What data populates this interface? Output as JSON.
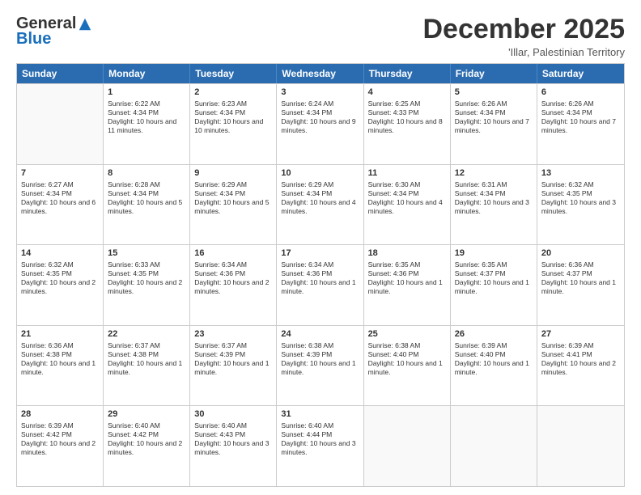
{
  "logo": {
    "general": "General",
    "blue": "Blue"
  },
  "title": "December 2025",
  "subtitle": "'Illar, Palestinian Territory",
  "header_days": [
    "Sunday",
    "Monday",
    "Tuesday",
    "Wednesday",
    "Thursday",
    "Friday",
    "Saturday"
  ],
  "weeks": [
    [
      {
        "day": "",
        "info": ""
      },
      {
        "day": "1",
        "info": "Sunrise: 6:22 AM\nSunset: 4:34 PM\nDaylight: 10 hours and 11 minutes."
      },
      {
        "day": "2",
        "info": "Sunrise: 6:23 AM\nSunset: 4:34 PM\nDaylight: 10 hours and 10 minutes."
      },
      {
        "day": "3",
        "info": "Sunrise: 6:24 AM\nSunset: 4:34 PM\nDaylight: 10 hours and 9 minutes."
      },
      {
        "day": "4",
        "info": "Sunrise: 6:25 AM\nSunset: 4:33 PM\nDaylight: 10 hours and 8 minutes."
      },
      {
        "day": "5",
        "info": "Sunrise: 6:26 AM\nSunset: 4:34 PM\nDaylight: 10 hours and 7 minutes."
      },
      {
        "day": "6",
        "info": "Sunrise: 6:26 AM\nSunset: 4:34 PM\nDaylight: 10 hours and 7 minutes."
      }
    ],
    [
      {
        "day": "7",
        "info": "Sunrise: 6:27 AM\nSunset: 4:34 PM\nDaylight: 10 hours and 6 minutes."
      },
      {
        "day": "8",
        "info": "Sunrise: 6:28 AM\nSunset: 4:34 PM\nDaylight: 10 hours and 5 minutes."
      },
      {
        "day": "9",
        "info": "Sunrise: 6:29 AM\nSunset: 4:34 PM\nDaylight: 10 hours and 5 minutes."
      },
      {
        "day": "10",
        "info": "Sunrise: 6:29 AM\nSunset: 4:34 PM\nDaylight: 10 hours and 4 minutes."
      },
      {
        "day": "11",
        "info": "Sunrise: 6:30 AM\nSunset: 4:34 PM\nDaylight: 10 hours and 4 minutes."
      },
      {
        "day": "12",
        "info": "Sunrise: 6:31 AM\nSunset: 4:34 PM\nDaylight: 10 hours and 3 minutes."
      },
      {
        "day": "13",
        "info": "Sunrise: 6:32 AM\nSunset: 4:35 PM\nDaylight: 10 hours and 3 minutes."
      }
    ],
    [
      {
        "day": "14",
        "info": "Sunrise: 6:32 AM\nSunset: 4:35 PM\nDaylight: 10 hours and 2 minutes."
      },
      {
        "day": "15",
        "info": "Sunrise: 6:33 AM\nSunset: 4:35 PM\nDaylight: 10 hours and 2 minutes."
      },
      {
        "day": "16",
        "info": "Sunrise: 6:34 AM\nSunset: 4:36 PM\nDaylight: 10 hours and 2 minutes."
      },
      {
        "day": "17",
        "info": "Sunrise: 6:34 AM\nSunset: 4:36 PM\nDaylight: 10 hours and 1 minute."
      },
      {
        "day": "18",
        "info": "Sunrise: 6:35 AM\nSunset: 4:36 PM\nDaylight: 10 hours and 1 minute."
      },
      {
        "day": "19",
        "info": "Sunrise: 6:35 AM\nSunset: 4:37 PM\nDaylight: 10 hours and 1 minute."
      },
      {
        "day": "20",
        "info": "Sunrise: 6:36 AM\nSunset: 4:37 PM\nDaylight: 10 hours and 1 minute."
      }
    ],
    [
      {
        "day": "21",
        "info": "Sunrise: 6:36 AM\nSunset: 4:38 PM\nDaylight: 10 hours and 1 minute."
      },
      {
        "day": "22",
        "info": "Sunrise: 6:37 AM\nSunset: 4:38 PM\nDaylight: 10 hours and 1 minute."
      },
      {
        "day": "23",
        "info": "Sunrise: 6:37 AM\nSunset: 4:39 PM\nDaylight: 10 hours and 1 minute."
      },
      {
        "day": "24",
        "info": "Sunrise: 6:38 AM\nSunset: 4:39 PM\nDaylight: 10 hours and 1 minute."
      },
      {
        "day": "25",
        "info": "Sunrise: 6:38 AM\nSunset: 4:40 PM\nDaylight: 10 hours and 1 minute."
      },
      {
        "day": "26",
        "info": "Sunrise: 6:39 AM\nSunset: 4:40 PM\nDaylight: 10 hours and 1 minute."
      },
      {
        "day": "27",
        "info": "Sunrise: 6:39 AM\nSunset: 4:41 PM\nDaylight: 10 hours and 2 minutes."
      }
    ],
    [
      {
        "day": "28",
        "info": "Sunrise: 6:39 AM\nSunset: 4:42 PM\nDaylight: 10 hours and 2 minutes."
      },
      {
        "day": "29",
        "info": "Sunrise: 6:40 AM\nSunset: 4:42 PM\nDaylight: 10 hours and 2 minutes."
      },
      {
        "day": "30",
        "info": "Sunrise: 6:40 AM\nSunset: 4:43 PM\nDaylight: 10 hours and 3 minutes."
      },
      {
        "day": "31",
        "info": "Sunrise: 6:40 AM\nSunset: 4:44 PM\nDaylight: 10 hours and 3 minutes."
      },
      {
        "day": "",
        "info": ""
      },
      {
        "day": "",
        "info": ""
      },
      {
        "day": "",
        "info": ""
      }
    ]
  ]
}
